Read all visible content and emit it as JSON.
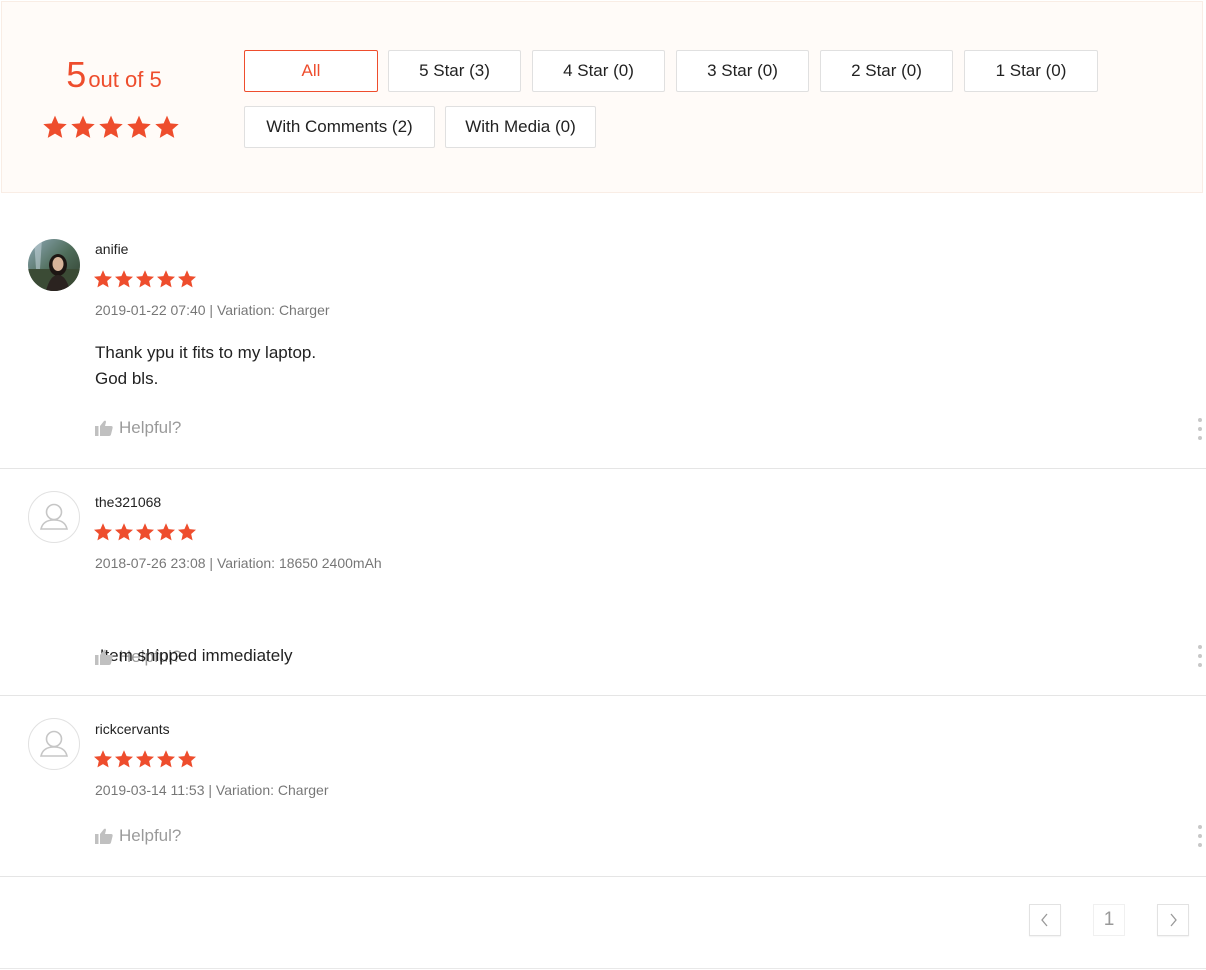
{
  "summary": {
    "score": "5",
    "score_suffix": "out of 5",
    "rating_stars": 5,
    "accent_color": "#ee4d2d",
    "filters": [
      {
        "label": "All",
        "active": true
      },
      {
        "label": "5 Star (3)",
        "active": false
      },
      {
        "label": "4 Star (0)",
        "active": false
      },
      {
        "label": "3 Star (0)",
        "active": false
      },
      {
        "label": "2 Star (0)",
        "active": false
      },
      {
        "label": "1 Star (0)",
        "active": false
      },
      {
        "label": "With Comments (2)",
        "active": false
      },
      {
        "label": "With Media (0)",
        "active": false
      }
    ]
  },
  "reviews": [
    {
      "username": "anifie",
      "stars": 5,
      "meta": "2019-01-22 07:40 | Variation: Charger",
      "comment_lines": [
        "Thank ypu it fits to my laptop.",
        "God bls."
      ],
      "helpful": "Helpful?",
      "avatar": "photo-avatar"
    },
    {
      "username": "the321068",
      "stars": 5,
      "meta": "2018-07-26 23:08 | Variation: 18650 2400mAh",
      "comment_lines": [
        " Item shipped immediately"
      ],
      "helpful": "Helpful?",
      "avatar": "user-placeholder-icon"
    },
    {
      "username": "rickcervants",
      "stars": 5,
      "meta": "2019-03-14 11:53 | Variation: Charger",
      "comment_lines": [],
      "helpful": "Helpful?",
      "avatar": "user-placeholder-icon"
    }
  ],
  "pagination": {
    "prev_icon": "chevron-left-icon",
    "current_page": "1",
    "next_icon": "chevron-right-icon"
  }
}
